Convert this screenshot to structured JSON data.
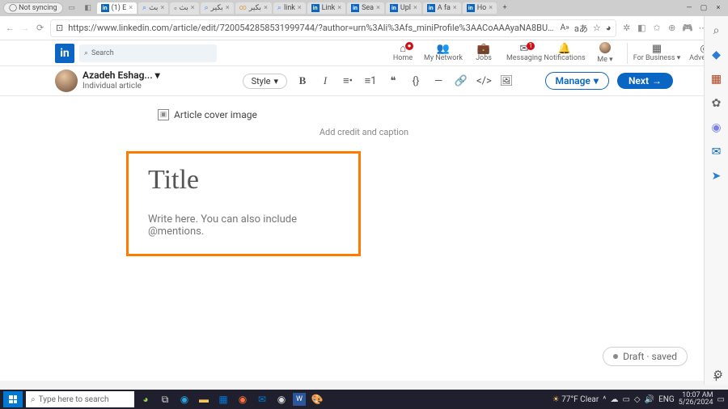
{
  "browser": {
    "sync_label": "Not syncing",
    "tabs": [
      {
        "label": "(1) E"
      },
      {
        "label": "بث"
      },
      {
        "label": "بث"
      },
      {
        "label": "بكير"
      },
      {
        "label": "بكير"
      },
      {
        "label": "link"
      },
      {
        "label": "Link"
      },
      {
        "label": "Sea"
      },
      {
        "label": "Upl"
      },
      {
        "label": "A fa"
      },
      {
        "label": "Ho"
      }
    ],
    "url": "https://www.linkedin.com/article/edit/7200542858531999744/?author=urn%3Ali%3Afs_miniProfile%3AACoAAAyaNA8BUR..."
  },
  "linkedin_nav": {
    "logo": "in",
    "search_placeholder": "Search",
    "items": {
      "home": {
        "label": "Home",
        "badge": "●"
      },
      "network": {
        "label": "My Network"
      },
      "jobs": {
        "label": "Jobs"
      },
      "messaging": {
        "label": "Messaging",
        "badge": "1"
      },
      "notifications": {
        "label": "Notifications"
      },
      "me": {
        "label": "Me ▾"
      },
      "business": {
        "label": "For Business ▾"
      },
      "advertise": {
        "label": "Advertise"
      }
    }
  },
  "editor": {
    "author_name": "Azadeh Eshag...",
    "author_sub": "Individual article",
    "style_label": "Style",
    "manage_label": "Manage",
    "next_label": "Next",
    "cover_alt": "Article cover image",
    "credit_caption": "Add credit and caption",
    "title_placeholder": "Title",
    "body_placeholder": "Write here. You can also include @mentions.",
    "draft_status": "Draft · saved"
  },
  "taskbar": {
    "search_placeholder": "Type here to search",
    "weather": "77°F  Clear",
    "lang": "ENG",
    "time": "10:07 AM",
    "date": "5/26/2024"
  }
}
